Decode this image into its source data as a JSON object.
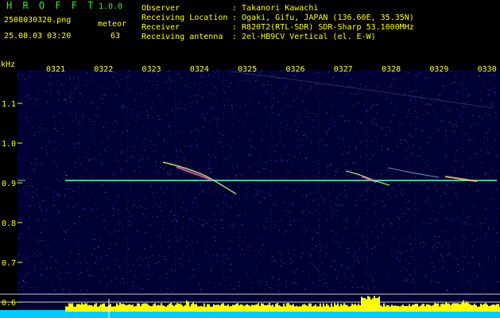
{
  "header": {
    "app_name": "H R O F F T",
    "version": "1.0.0",
    "filename": "2508030320.png",
    "timestamp": "25.08.03 03:20",
    "detection_label": "meteor",
    "detection_count": "63"
  },
  "info": [
    {
      "label": "Observer",
      "value": ": Takanori Kawachi"
    },
    {
      "label": "Receiving Location",
      "value": ": Ogaki, Gifu, JAPAN (136.60E, 35.35N)"
    },
    {
      "label": "Receiver",
      "value": ": R820T2(RTL-SDR) SDR-Sharp 53.1000MHz"
    },
    {
      "label": "Receiving antenna",
      "value": ": 2el-HB9CV Vertical (el. E-W)"
    }
  ],
  "spectrogram": {
    "y_unit": "kHz",
    "y_ticks": [
      "1.1",
      "1.0",
      "0.9",
      "0.8",
      "0.7",
      "0.6"
    ],
    "time_ticks": [
      "0321",
      "0322",
      "0323",
      "0324",
      "0325",
      "0326",
      "0327",
      "0328",
      "0329",
      "0330"
    ],
    "carrier_khz": 0.905,
    "colors": {
      "axis_label": "#ffff00",
      "header_text": "#33ee33",
      "background": "#000033",
      "carrier": "#66ffcc",
      "level_bars": "#ffff00",
      "level_base": "#00ccff"
    }
  }
}
